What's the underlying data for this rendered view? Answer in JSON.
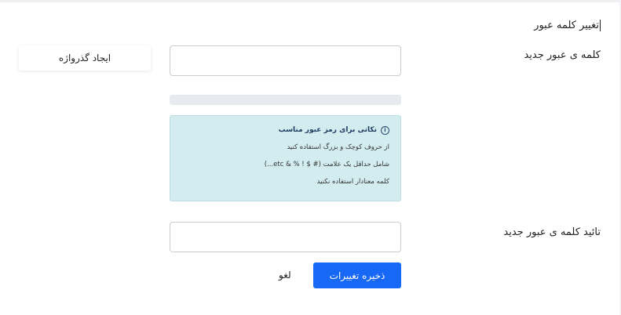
{
  "title": "تغییر کلمه عبور",
  "new_password": {
    "label": "کلمه ی عبور جدید",
    "value": ""
  },
  "generate_button_label": "ایجاد گذرواژه",
  "strength_meter": {
    "level": 0
  },
  "tips": {
    "heading": "نکاتی برای رمز عبور مناسب",
    "icon": "info-icon",
    "items": [
      "از حروف کوچک و بزرگ استفاده کنید",
      "شامل حداقل یک علامت (# $ ! % & etc...)",
      "کلمه معنادار استفاده نکنید"
    ]
  },
  "confirm_password": {
    "label": "تائید کلمه ی عبور جدید",
    "value": ""
  },
  "actions": {
    "save_label": "ذخیره تغییرات",
    "cancel_label": "لغو"
  },
  "colors": {
    "primary": "#1769f5",
    "tips_background": "#d3ecef",
    "meter_track": "#e7eaee"
  }
}
